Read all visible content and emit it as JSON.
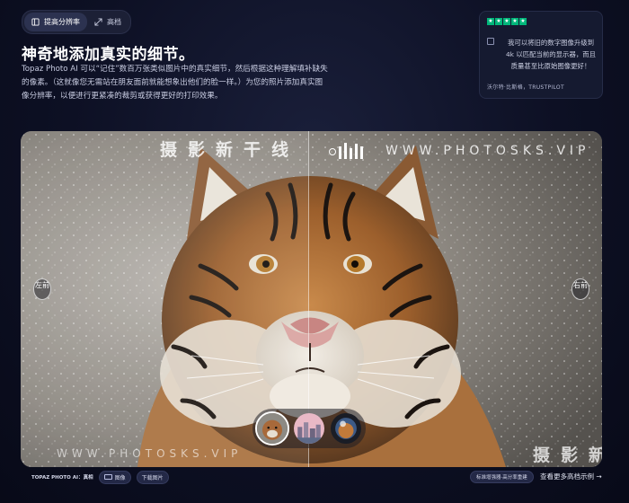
{
  "tabs": [
    {
      "label": "提高分辨率",
      "icon": "panel-icon",
      "active": true
    },
    {
      "label": "高档",
      "icon": "expand-arrows-icon",
      "active": false
    }
  ],
  "headline": "神奇地添加真实的细节。",
  "description": "Topaz Photo AI 可以“记住”数百万张类似图片中的真实细节，然后根据这种理解填补缺失的像素。（这就像您无需站在朋友面前就能想象出他们的脸一样。）为您的照片添加真实图像分辨率，以便进行更紧凑的裁剪或获得更好的打印效果。",
  "review": {
    "rating": 5,
    "source_color": "#00b67a",
    "quote": "我可以将旧的数字图像升级到 4k 以匹配当前的显示器，而且质量甚至比原始图像更好！",
    "author": "沃尔特·比斯格，TRUSTPILOT"
  },
  "viewer": {
    "left_label": "左前",
    "right_label": "右前",
    "watermark_cn": "摄影新干线",
    "watermark_en": "WWW.PHOTOSKS.VIP",
    "watermark_en_bottom": "WWW.PHOTOSKS.VIP",
    "watermark_cn_bottom": "摄影新",
    "thumbnails": [
      {
        "name": "tiger",
        "active": true
      },
      {
        "name": "city",
        "active": false
      },
      {
        "name": "orb",
        "active": false
      }
    ]
  },
  "bottom_bar": {
    "brand": "TOPAZ PHOTO AI：真相",
    "image_label": "图像",
    "download_label": "下载图片",
    "model_label": "标准增强器·高分率重建",
    "more_link": "查看更多高档示例 →"
  }
}
